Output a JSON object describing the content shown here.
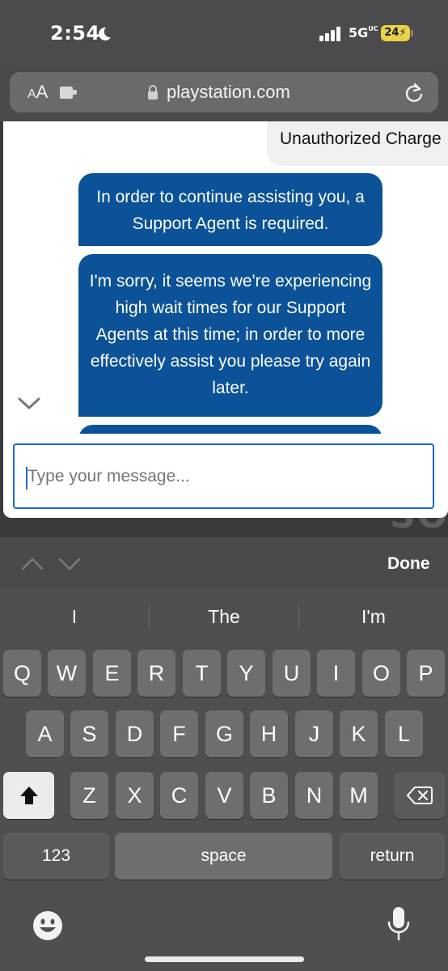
{
  "status_bar": {
    "time": "2:54",
    "network": "5G",
    "network_suffix": "UC",
    "battery": "24"
  },
  "browser": {
    "text_size_label_small": "A",
    "text_size_label_large": "A",
    "url": "playstation.com",
    "background_text": "SO"
  },
  "chat": {
    "user_message": "Unauthorized Charge",
    "agent_messages": [
      "In order to continue assisting you, a Support Agent is required.",
      "I'm sorry, it seems we're experiencing high wait times for our Support Agents at this time; in order to more effectively assist you please try again later."
    ],
    "input_placeholder": "Type your message..."
  },
  "keyboard_toolbar": {
    "done_label": "Done"
  },
  "keyboard": {
    "suggestions": [
      "I",
      "The",
      "I'm"
    ],
    "row1": [
      "Q",
      "W",
      "E",
      "R",
      "T",
      "Y",
      "U",
      "I",
      "O",
      "P"
    ],
    "row2": [
      "A",
      "S",
      "D",
      "F",
      "G",
      "H",
      "J",
      "K",
      "L"
    ],
    "row3": [
      "Z",
      "X",
      "C",
      "V",
      "B",
      "N",
      "M"
    ],
    "numbers_label": "123",
    "space_label": "space",
    "return_label": "return"
  },
  "colors": {
    "agent_bubble": "#0b5298",
    "input_border": "#1a67c9",
    "battery": "#e9d24a"
  }
}
